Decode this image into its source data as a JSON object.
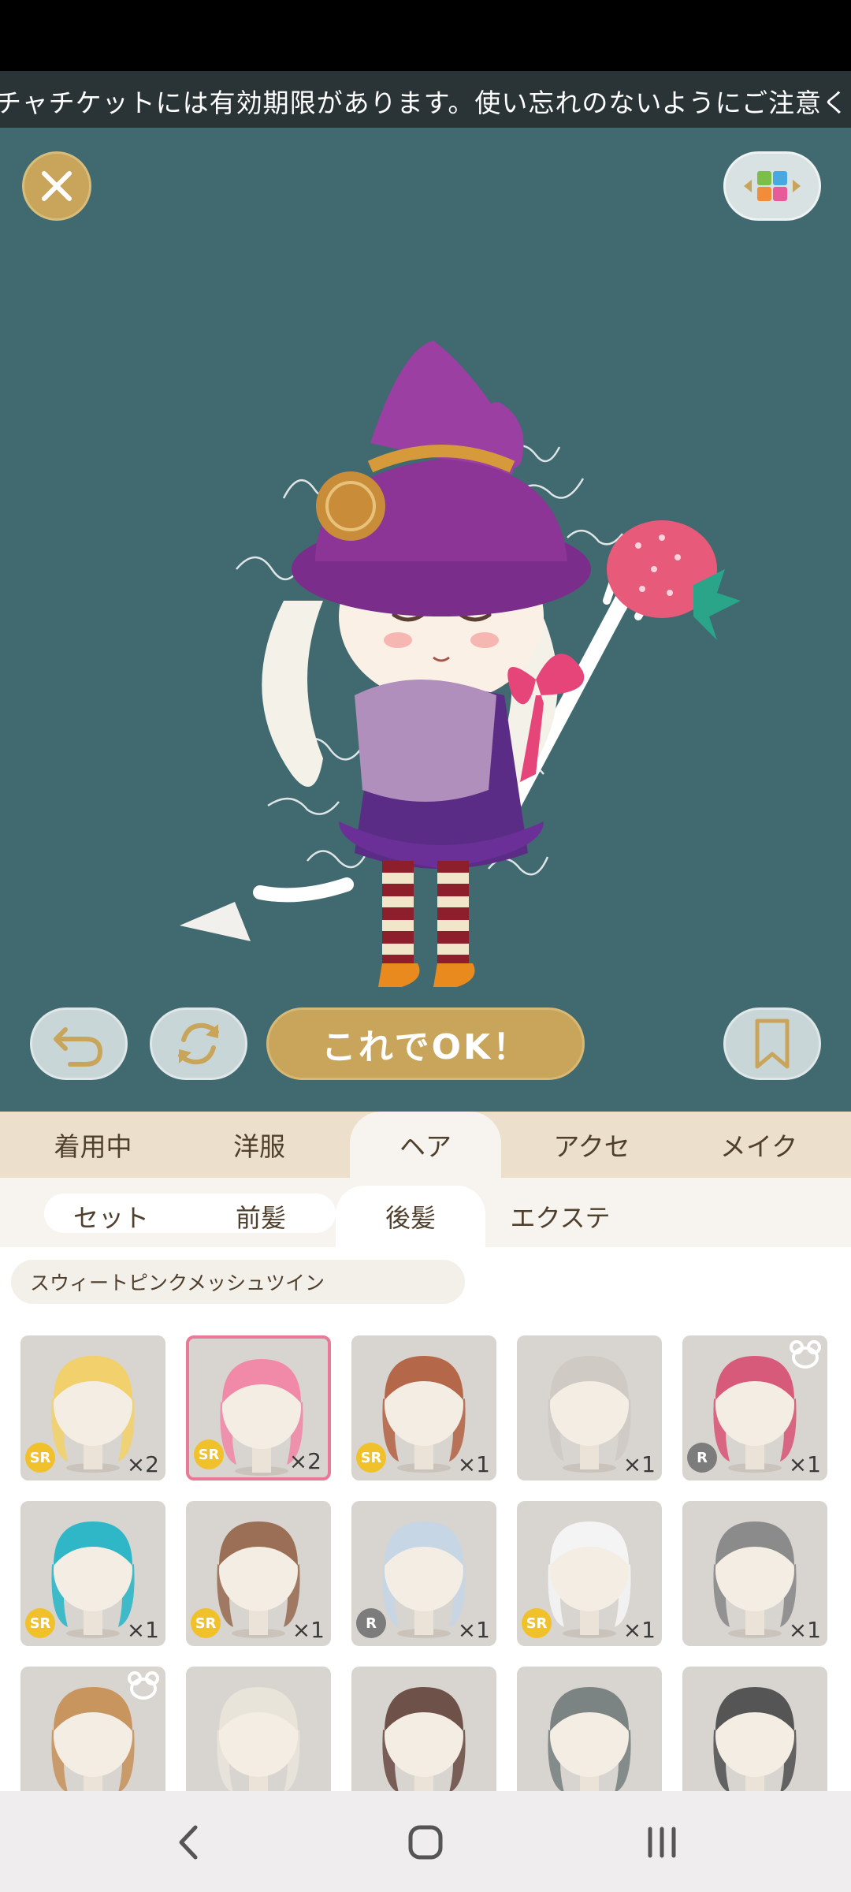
{
  "ticker": {
    "text": "チャチケットには有効期限があります。使い忘れのないようにご注意く"
  },
  "stage": {
    "close_icon": "close-icon",
    "color_icon": "color-palette-icon",
    "undo_icon": "undo-icon",
    "reset_icon": "refresh-icon",
    "bookmark_icon": "bookmark-icon",
    "ok_label": "これでOK！"
  },
  "category_tabs": [
    {
      "label": "着用中"
    },
    {
      "label": "洋服"
    },
    {
      "label": "ヘア",
      "active": true
    },
    {
      "label": "アクセ"
    },
    {
      "label": "メイク"
    }
  ],
  "sub_tabs": [
    {
      "label": "セット"
    },
    {
      "label": "前髪"
    },
    {
      "label": "後髪",
      "active": true
    },
    {
      "label": "エクステ"
    }
  ],
  "selected_item_name": "スウィートピンクメッシュツイン",
  "items": [
    {
      "rarity": "SR",
      "count": "×2",
      "hair_color": "#f2d06b",
      "selected": false,
      "bear": false
    },
    {
      "rarity": "SR",
      "count": "×2",
      "hair_color": "#f08aa8",
      "selected": true,
      "bear": false
    },
    {
      "rarity": "SR",
      "count": "×1",
      "hair_color": "#b5674a",
      "selected": false,
      "bear": false
    },
    {
      "rarity": "",
      "count": "×1",
      "hair_color": "#cfcac4",
      "selected": false,
      "bear": false
    },
    {
      "rarity": "R",
      "count": "×1",
      "hair_color": "#d85a7a",
      "selected": false,
      "bear": true
    },
    {
      "rarity": "SR",
      "count": "×1",
      "hair_color": "#2fb7c7",
      "selected": false,
      "bear": false
    },
    {
      "rarity": "SR",
      "count": "×1",
      "hair_color": "#9a6f55",
      "selected": false,
      "bear": false
    },
    {
      "rarity": "R",
      "count": "×1",
      "hair_color": "#c7d6e4",
      "selected": false,
      "bear": false
    },
    {
      "rarity": "SR",
      "count": "×1",
      "hair_color": "#f4f4f4",
      "selected": false,
      "bear": false
    },
    {
      "rarity": "",
      "count": "×1",
      "hair_color": "#8b8b8b",
      "selected": false,
      "bear": false
    },
    {
      "rarity": "",
      "count": "",
      "hair_color": "#c9955e",
      "selected": false,
      "bear": true
    },
    {
      "rarity": "",
      "count": "",
      "hair_color": "#e9e4da",
      "selected": false,
      "bear": false
    },
    {
      "rarity": "",
      "count": "",
      "hair_color": "#6e5148",
      "selected": false,
      "bear": false
    },
    {
      "rarity": "",
      "count": "",
      "hair_color": "#7b8383",
      "selected": false,
      "bear": false
    },
    {
      "rarity": "",
      "count": "",
      "hair_color": "#555555",
      "selected": false,
      "bear": false
    }
  ],
  "navbar": {
    "back_icon": "back-icon",
    "home_icon": "home-icon",
    "recents_icon": "recents-icon"
  },
  "colors": {
    "stage_bg": "#416970",
    "accent_gold": "#c8a55b",
    "tab_bg": "#ece0cc",
    "selected_pink": "#e87a98"
  }
}
